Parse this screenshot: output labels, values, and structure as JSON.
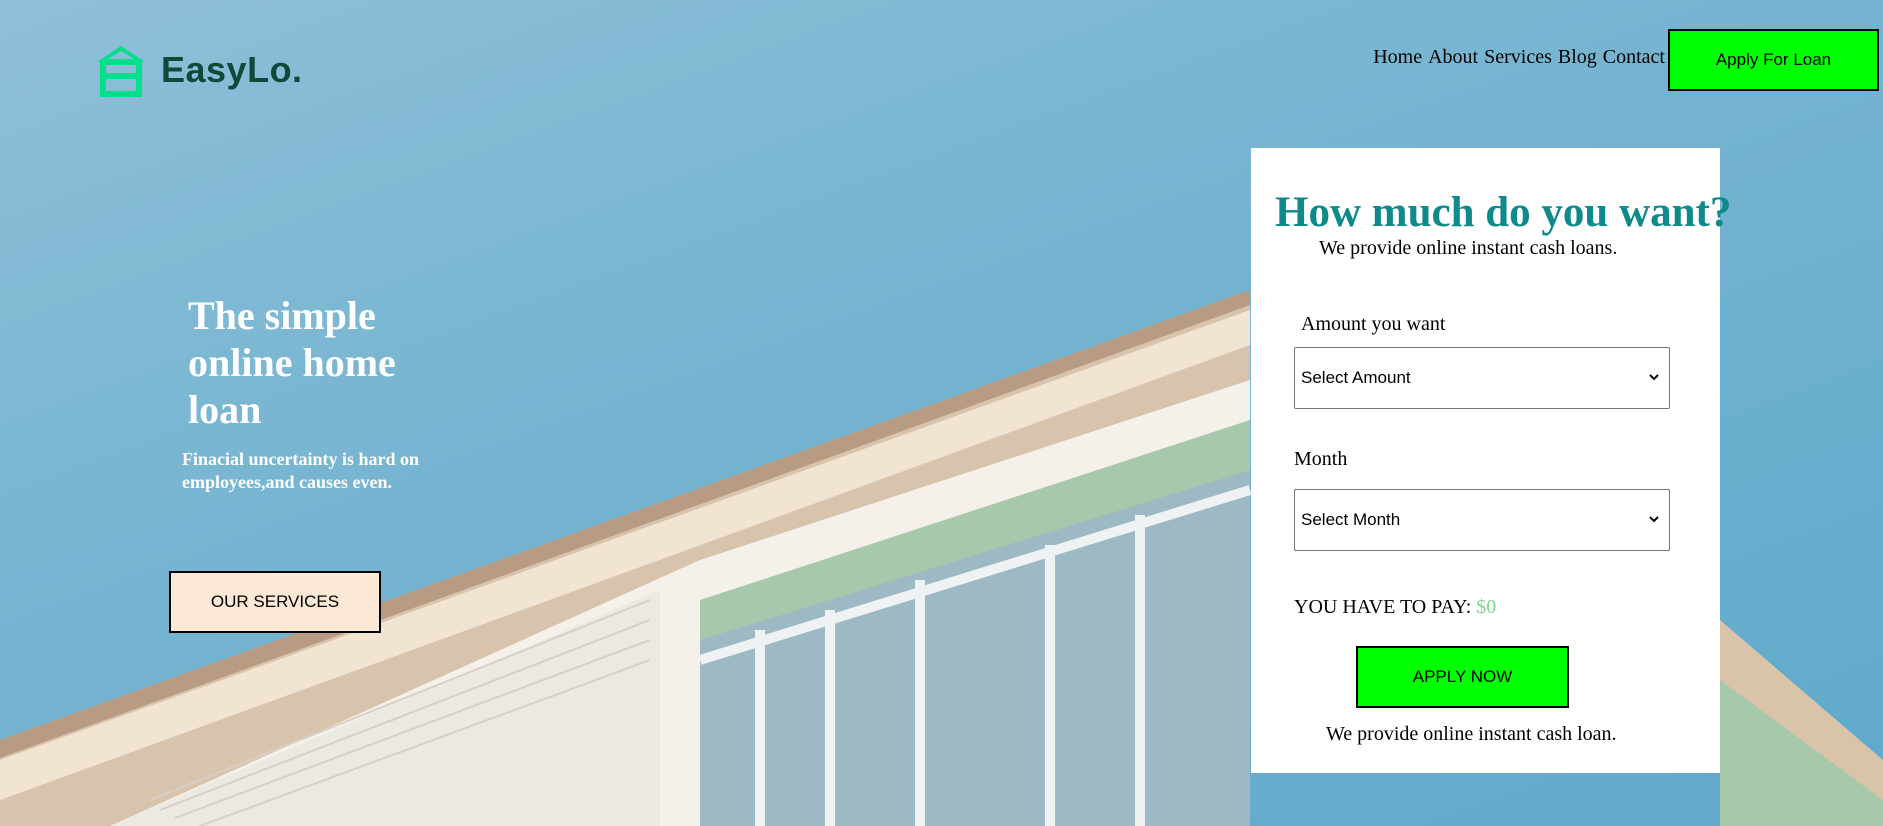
{
  "brand": {
    "name": "EasyLo.",
    "icon": "house-icon",
    "color": "#00e08a"
  },
  "nav": {
    "items": [
      {
        "label": "Home"
      },
      {
        "label": "About"
      },
      {
        "label": "Services"
      },
      {
        "label": "Blog"
      },
      {
        "label": "Contact"
      }
    ],
    "cta_label": "Apply For Loan",
    "cta_color": "#00ff00"
  },
  "hero": {
    "title": "The simple online home loan",
    "subtitle": "Finacial uncertainty is hard on employees,and causes even.",
    "button_label": "OUR SERVICES",
    "button_color": "#fbe9d5"
  },
  "loan_card": {
    "title": "How much do you want?",
    "subtitle": "We provide online instant cash loans.",
    "amount_label": "Amount you want",
    "amount_selected": "Select Amount",
    "month_label": "Month",
    "month_selected": "Select Month",
    "pay_label": "YOU HAVE TO PAY:",
    "pay_value": "$0",
    "apply_label": "APPLY NOW",
    "footer": "We provide online instant cash loan.",
    "title_color": "#0e8a8a",
    "pay_value_color": "#7bd88f"
  }
}
